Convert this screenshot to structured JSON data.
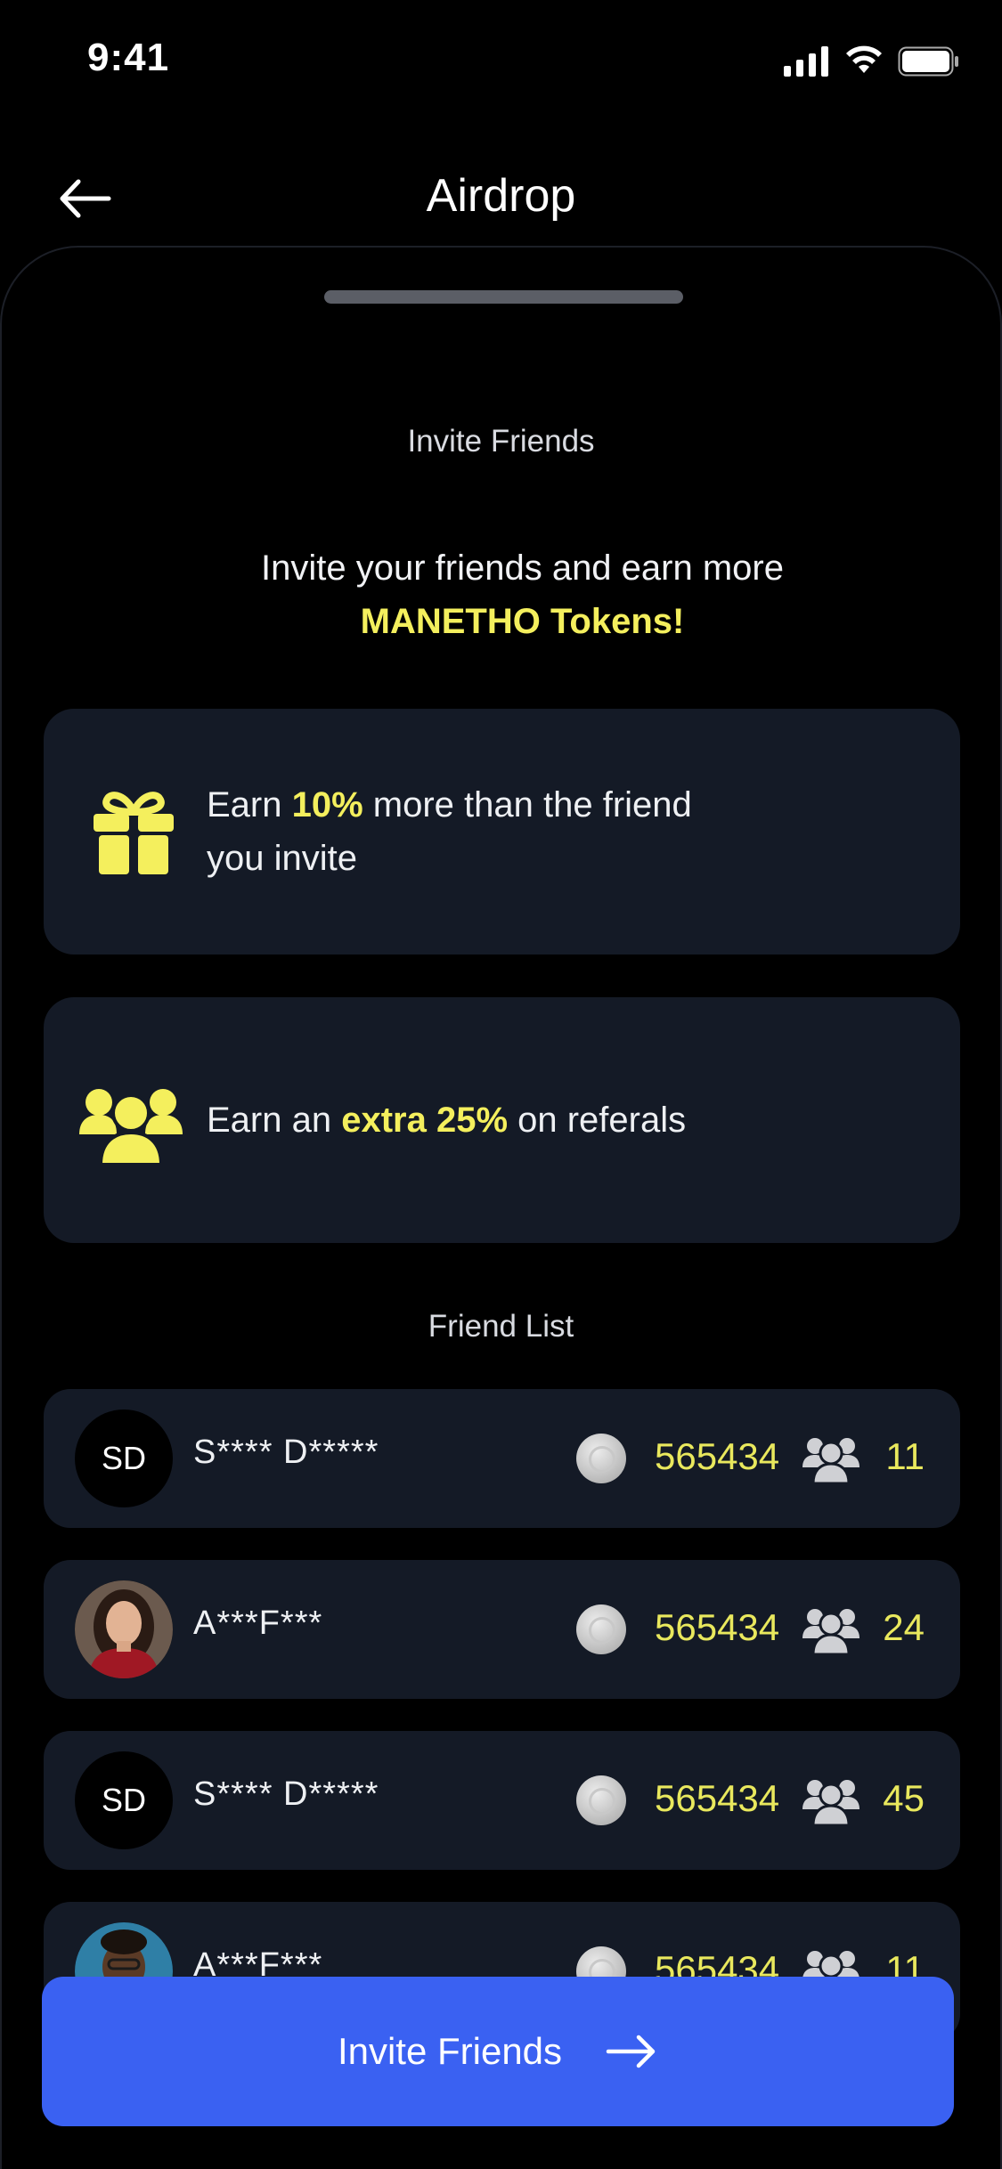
{
  "status_bar": {
    "time": "9:41"
  },
  "nav": {
    "title": "Airdrop"
  },
  "invite_section": {
    "title": "Invite Friends",
    "headline": "Invite your friends and earn more",
    "headline_accent": "MANETHO Tokens!"
  },
  "features": [
    {
      "icon": "gift-icon",
      "prefix": "Earn ",
      "highlight": "10%",
      "suffix": " more than the friend",
      "line2": "you invite"
    },
    {
      "icon": "group-icon",
      "prefix": "Earn an ",
      "highlight": "extra 25%",
      "suffix": " on referals"
    }
  ],
  "friend_list": {
    "title": "Friend List",
    "items": [
      {
        "initials": "SD",
        "name": "S**** D*****",
        "tokens": "565434",
        "referrals": "11",
        "avatar": "initials"
      },
      {
        "initials": "",
        "name": "A***F***",
        "tokens": "565434",
        "referrals": "24",
        "avatar": "photo"
      },
      {
        "initials": "SD",
        "name": "S**** D*****",
        "tokens": "565434",
        "referrals": "45",
        "avatar": "initials"
      },
      {
        "initials": "",
        "name": "A***F***",
        "tokens": "565434",
        "referrals": "11",
        "avatar": "photo"
      }
    ]
  },
  "cta": {
    "label": "Invite Friends"
  },
  "colors": {
    "accent": "#f4ef5d",
    "card": "#141a26",
    "button": "#3a61f2"
  }
}
